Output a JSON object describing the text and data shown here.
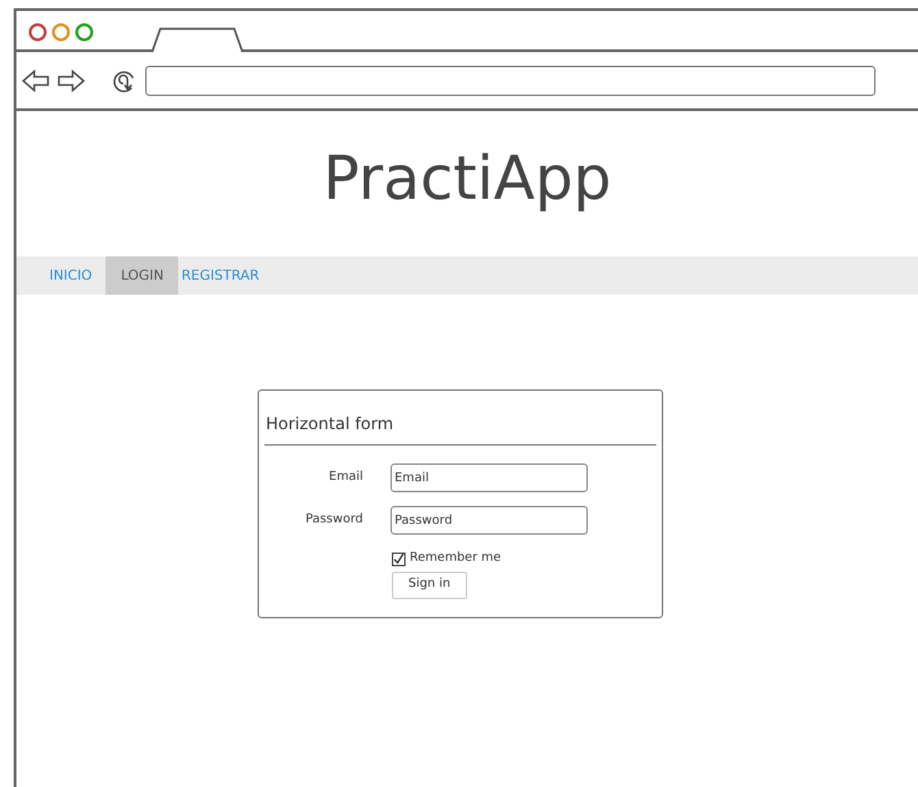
{
  "app_title": "PractiApp",
  "nav": [
    {
      "label": "INICIO",
      "selected": false
    },
    {
      "label": "LOGIN",
      "selected": true
    },
    {
      "label": "REGISTRAR",
      "selected": false
    }
  ],
  "form": {
    "title": "Horizontal form",
    "fields": [
      {
        "label": "Email",
        "placeholder": "Email"
      },
      {
        "label": "Password",
        "placeholder": "Password"
      }
    ],
    "remember": {
      "label": "Remember me",
      "checked": true
    },
    "submit": "Sign in"
  }
}
